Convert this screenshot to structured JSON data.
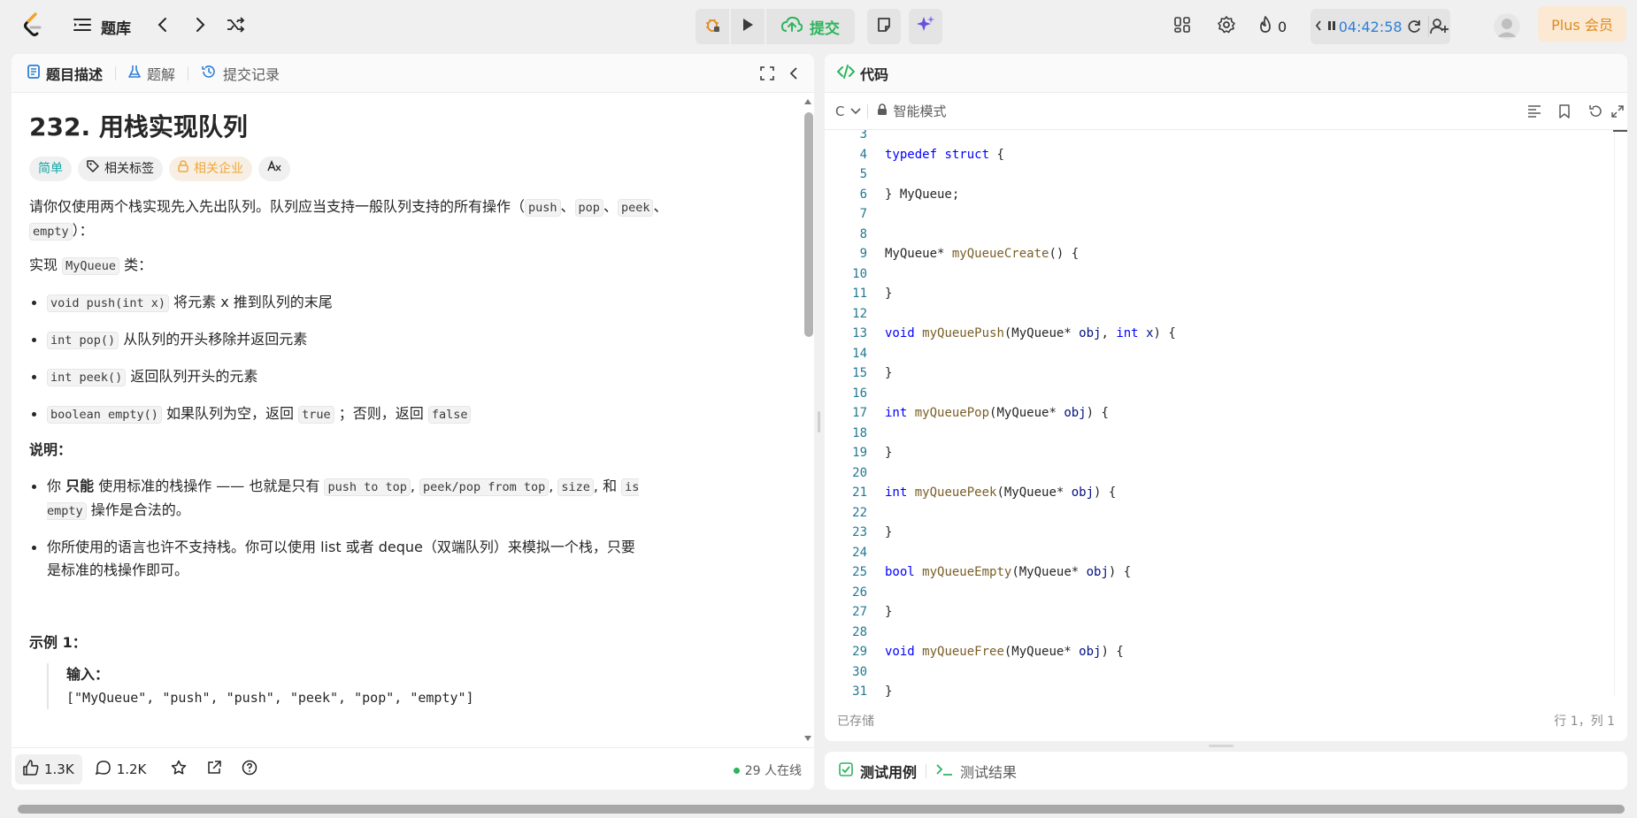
{
  "nav": {
    "problem_list_label": "题库",
    "submit_label": "提交",
    "streak_count": "0",
    "timer": "04:42:58",
    "plus_label": "Plus 会员",
    "icons": [
      "logo-icon",
      "list-icon",
      "chevron-left-icon",
      "chevron-right-icon",
      "shuffle-icon",
      "debug-icon",
      "play-icon",
      "cloud-upload-icon",
      "note-icon",
      "sparkle-icon",
      "layout-icon",
      "gear-icon",
      "flame-icon",
      "pause-icon",
      "reset-icon",
      "add-user-icon"
    ]
  },
  "left": {
    "tabs": [
      {
        "label": "题目描述",
        "icon": "document-icon",
        "color": "#2e7fd6"
      },
      {
        "label": "题解",
        "icon": "flask-icon",
        "color": "#2e7fd6"
      },
      {
        "label": "提交记录",
        "icon": "history-icon",
        "color": "#2e7fd6"
      }
    ],
    "title": "232. 用栈实现队列",
    "tags": {
      "difficulty": "简单",
      "topics": "相关标签",
      "company": "相关企业",
      "translate": "A文"
    },
    "intro": {
      "t1": "请你仅使用两个栈实现先入先出队列。队列应当支持一般队列支持的所有操作（",
      "c1": "push",
      "s1": "、",
      "c2": "pop",
      "s2": "、",
      "c3": "peek",
      "s3": "、",
      "c4": "empty",
      "t2": "）："
    },
    "impl": {
      "t1": "实现 ",
      "code": "MyQueue",
      "t2": " 类："
    },
    "methods": [
      {
        "code": "void push(int x)",
        "text": " 将元素 x 推到队列的末尾"
      },
      {
        "code": "int pop()",
        "text": " 从队列的开头移除并返回元素"
      },
      {
        "code": "int peek()",
        "text": " 返回队列开头的元素"
      }
    ],
    "empty_item": {
      "code": "boolean empty()",
      "t1": " 如果队列为空，返回 ",
      "c_true": "true",
      "t2": " ；否则，返回 ",
      "c_false": "false"
    },
    "notes_heading": "说明：",
    "note1": {
      "t1": "你 ",
      "strong": "只能",
      "t2": " 使用标准的栈操作 —— 也就是只有 ",
      "c1": "push to top",
      "s1": ", ",
      "c2": "peek/pop from top",
      "s2": ", ",
      "c3": "size",
      "s3": ", 和 ",
      "c4": "is empty",
      "t3": " 操作是合法的。"
    },
    "note2": "你所使用的语言也许不支持栈。你可以使用 list 或者 deque（双端队列）来模拟一个栈，只要是标准的栈操作即可。",
    "example_heading": "示例 1：",
    "example_input_label": "输入：",
    "example_input": "[\"MyQueue\", \"push\", \"push\", \"peek\", \"pop\", \"empty\"]",
    "footer": {
      "likes": "1.3K",
      "comments": "1.2K",
      "online": "29 人在线"
    }
  },
  "right": {
    "code_title": "代码",
    "language": "C",
    "mode": "智能模式",
    "saved": "已存储",
    "cursor": "行 1，列 1",
    "testcases_tab": "测试用例",
    "results_tab": "测试结果"
  },
  "code_lines": [
    {
      "n": "3",
      "tokens": []
    },
    {
      "n": "4",
      "tokens": [
        {
          "t": "typedef",
          "c": "kw"
        },
        {
          "t": " "
        },
        {
          "t": "struct",
          "c": "kw"
        },
        {
          "t": " {"
        }
      ]
    },
    {
      "n": "5",
      "tokens": []
    },
    {
      "n": "6",
      "tokens": [
        {
          "t": "} MyQueue;"
        }
      ]
    },
    {
      "n": "7",
      "tokens": []
    },
    {
      "n": "8",
      "tokens": []
    },
    {
      "n": "9",
      "tokens": [
        {
          "t": "MyQueue* "
        },
        {
          "t": "myQueueCreate",
          "c": "fn"
        },
        {
          "t": "() {"
        }
      ]
    },
    {
      "n": "10",
      "tokens": []
    },
    {
      "n": "11",
      "tokens": [
        {
          "t": "}"
        }
      ]
    },
    {
      "n": "12",
      "tokens": []
    },
    {
      "n": "13",
      "tokens": [
        {
          "t": "void",
          "c": "kw"
        },
        {
          "t": " "
        },
        {
          "t": "myQueuePush",
          "c": "fn"
        },
        {
          "t": "(MyQueue* "
        },
        {
          "t": "obj",
          "c": "id"
        },
        {
          "t": ", "
        },
        {
          "t": "int",
          "c": "kw"
        },
        {
          "t": " "
        },
        {
          "t": "x",
          "c": "id"
        },
        {
          "t": ") {"
        }
      ]
    },
    {
      "n": "14",
      "tokens": []
    },
    {
      "n": "15",
      "tokens": [
        {
          "t": "}"
        }
      ]
    },
    {
      "n": "16",
      "tokens": []
    },
    {
      "n": "17",
      "tokens": [
        {
          "t": "int",
          "c": "kw"
        },
        {
          "t": " "
        },
        {
          "t": "myQueuePop",
          "c": "fn"
        },
        {
          "t": "(MyQueue* "
        },
        {
          "t": "obj",
          "c": "id"
        },
        {
          "t": ") {"
        }
      ]
    },
    {
      "n": "18",
      "tokens": []
    },
    {
      "n": "19",
      "tokens": [
        {
          "t": "}"
        }
      ]
    },
    {
      "n": "20",
      "tokens": []
    },
    {
      "n": "21",
      "tokens": [
        {
          "t": "int",
          "c": "kw"
        },
        {
          "t": " "
        },
        {
          "t": "myQueuePeek",
          "c": "fn"
        },
        {
          "t": "(MyQueue* "
        },
        {
          "t": "obj",
          "c": "id"
        },
        {
          "t": ") {"
        }
      ]
    },
    {
      "n": "22",
      "tokens": []
    },
    {
      "n": "23",
      "tokens": [
        {
          "t": "}"
        }
      ]
    },
    {
      "n": "24",
      "tokens": []
    },
    {
      "n": "25",
      "tokens": [
        {
          "t": "bool",
          "c": "kw"
        },
        {
          "t": " "
        },
        {
          "t": "myQueueEmpty",
          "c": "fn"
        },
        {
          "t": "(MyQueue* "
        },
        {
          "t": "obj",
          "c": "id"
        },
        {
          "t": ") {"
        }
      ]
    },
    {
      "n": "26",
      "tokens": []
    },
    {
      "n": "27",
      "tokens": [
        {
          "t": "}"
        }
      ]
    },
    {
      "n": "28",
      "tokens": []
    },
    {
      "n": "29",
      "tokens": [
        {
          "t": "void",
          "c": "kw"
        },
        {
          "t": " "
        },
        {
          "t": "myQueueFree",
          "c": "fn"
        },
        {
          "t": "(MyQueue* "
        },
        {
          "t": "obj",
          "c": "id"
        },
        {
          "t": ") {"
        }
      ]
    },
    {
      "n": "30",
      "tokens": []
    },
    {
      "n": "31",
      "tokens": [
        {
          "t": "}"
        }
      ]
    }
  ],
  "colors": {
    "accent_blue": "#2e7fd6",
    "submit_green": "#2db55d",
    "plus_orange": "#e08a1e",
    "difficulty_teal": "#13a8a8"
  }
}
